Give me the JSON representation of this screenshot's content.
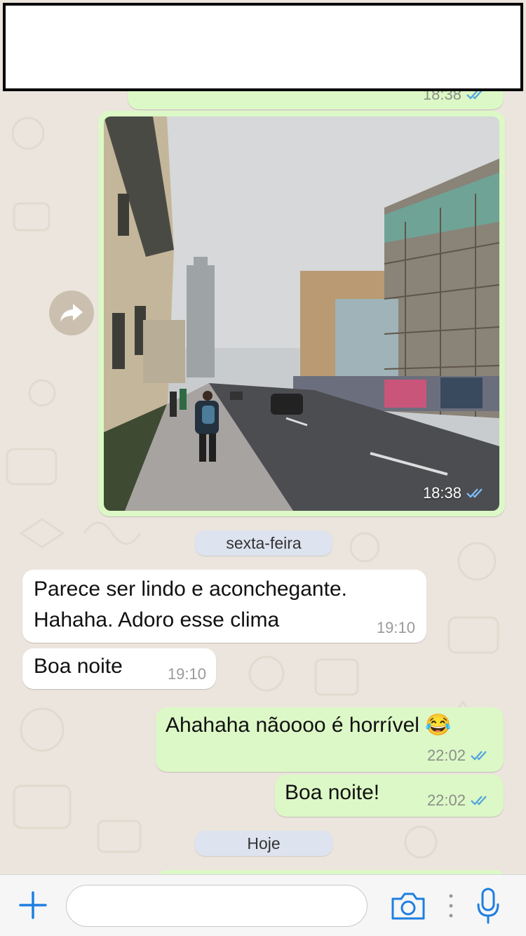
{
  "chat": {
    "messages": [
      {
        "id": "partial-top",
        "time": "18:38",
        "direction": "out"
      },
      {
        "id": "photo",
        "time": "18:38",
        "direction": "out",
        "type": "image"
      },
      {
        "id": "m1",
        "direction": "in",
        "text": "Parece ser lindo e aconchegante.\nHahaha. Adoro esse clima",
        "time": "19:10"
      },
      {
        "id": "m2",
        "direction": "in",
        "text": "Boa noite",
        "time": "19:10"
      },
      {
        "id": "m3",
        "direction": "out",
        "text": "Ahahaha nãoooo é horrível 😂",
        "time": "22:02"
      },
      {
        "id": "m4",
        "direction": "out",
        "text": "Boa noite!",
        "time": "22:02"
      }
    ],
    "date_separators": [
      "sexta-feira",
      "Hoje"
    ]
  },
  "input": {
    "placeholder": ""
  },
  "icons": [
    "forward-icon",
    "plus-icon",
    "camera-icon",
    "more-dots-icon",
    "microphone-icon",
    "read-receipt-icon"
  ],
  "colors": {
    "outgoing_bubble": "#dcf8c6",
    "incoming_bubble": "#ffffff",
    "wallpaper": "#ece5dd",
    "read_ticks": "#4fa3e0",
    "accent": "#1d7fe0"
  }
}
